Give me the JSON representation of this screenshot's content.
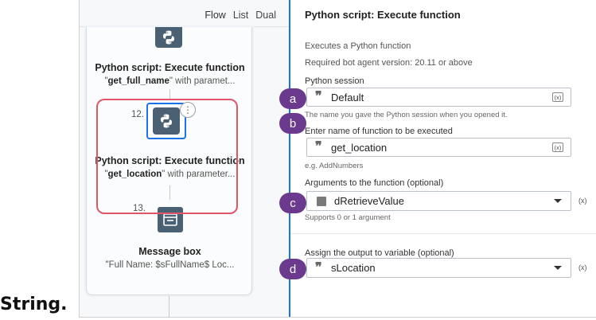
{
  "lead_text": "String.",
  "view_tabs": [
    "Flow",
    "List",
    "Dual"
  ],
  "flow": {
    "step11": {
      "title": "Python script: Execute function",
      "sub_prefix": "\"",
      "sub_bold": "get_full_name",
      "sub_rest": "\" with paramet..."
    },
    "step12": {
      "number": "12.",
      "title": "Python script: Execute function",
      "sub_prefix": "\"",
      "sub_bold": "get_location",
      "sub_rest": "\" with parameter..."
    },
    "step13": {
      "number": "13.",
      "title": "Message box",
      "sub": "\"Full Name: $sFullName$ Loc..."
    }
  },
  "props": {
    "title": "Python script: Execute function",
    "description": "Executes a Python function",
    "required_version": "Required bot agent version: 20.11 or above",
    "python_session": {
      "label": "Python session",
      "value": "Default",
      "hint": "The name you gave the Python session when you opened it."
    },
    "function_name": {
      "label": "Enter name of function to be executed",
      "value": "get_location",
      "hint": "e.g. AddNumbers"
    },
    "arguments": {
      "label": "Arguments to the function (optional)",
      "value": "dRetrieveValue",
      "hint": "Supports 0 or 1 argument"
    },
    "output": {
      "label": "Assign the output to variable (optional)",
      "value": "sLocation"
    },
    "var_button": "(x)"
  },
  "callouts": [
    "a",
    "b",
    "c",
    "d"
  ],
  "colors": {
    "callout": "#6b3a8f",
    "highlight_border": "#e05567",
    "selection_blue": "#1a73e8",
    "tile": "#4a6174"
  }
}
